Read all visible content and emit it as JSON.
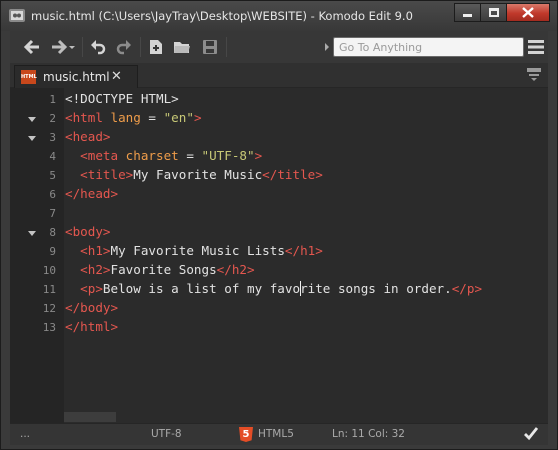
{
  "window": {
    "title": "music.html (C:\\Users\\JayTray\\Desktop\\WEBSITE) - Komodo Edit 9.0"
  },
  "toolbar": {
    "buttons": [
      "back-icon",
      "forward-icon",
      "undo-icon",
      "redo-icon",
      "new-file-icon",
      "open-folder-icon",
      "save-icon",
      "menu-icon"
    ],
    "search_placeholder": "Go To Anything"
  },
  "tabs": [
    {
      "label": "music.html",
      "icon_text": "HTML",
      "close_glyph": "✕"
    }
  ],
  "editor": {
    "lines": [
      {
        "num": "1"
      },
      {
        "num": "2"
      },
      {
        "num": "3"
      },
      {
        "num": "4"
      },
      {
        "num": "5"
      },
      {
        "num": "6"
      },
      {
        "num": "7"
      },
      {
        "num": "8"
      },
      {
        "num": "9"
      },
      {
        "num": "10"
      },
      {
        "num": "11"
      },
      {
        "num": "12"
      },
      {
        "num": "13"
      }
    ],
    "tokens": {
      "doctype": "<!DOCTYPE HTML>",
      "html_open": "<html",
      "lang_attr": " lang",
      "lang_eq": " = ",
      "lang_val": "\"en\"",
      "gt": ">",
      "head_open": "<head>",
      "meta_open": "<meta",
      "charset_attr": " charset",
      "charset_eq": " = ",
      "charset_val": "\"UTF-8\"",
      "title_open": "<title>",
      "title_text": "My Favorite Music",
      "title_close": "</title>",
      "head_close": "</head>",
      "body_open": "<body>",
      "h1_open": "<h1>",
      "h1_text": "My Favorite Music Lists",
      "h1_close": "</h1>",
      "h2_open": "<h2>",
      "h2_text": "Favorite Songs",
      "h2_close": "</h2>",
      "p_open": "<p>",
      "p_text_a": "Below is a list of my favo",
      "p_text_b": "rite songs in order.",
      "p_close": "</p>",
      "body_close": "</body>",
      "html_close": "</html>"
    }
  },
  "statusbar": {
    "left": "...",
    "encoding": "UTF-8",
    "language": "HTML5",
    "position": "Ln: 11 Col: 32"
  },
  "colors": {
    "tag": "#e4574f",
    "attribute": "#ee9c4a",
    "string": "#c7c876",
    "text": "#e2e2e2",
    "background": "#2b2b2b"
  }
}
